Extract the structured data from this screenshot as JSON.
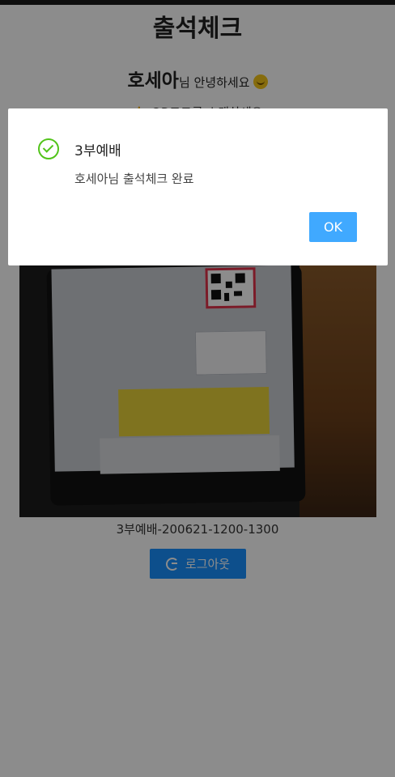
{
  "page": {
    "title": "출석체크",
    "greeting_name": "호세아",
    "greeting_rest": "님 안녕하세요",
    "instruction": "👉 QR코드를 스캔하세요",
    "scan_caption": "3부예배-200621-1200-1300",
    "logout_label": "로그아웃"
  },
  "modal": {
    "title": "3부예배",
    "content": "호세아님 출석체크 완료",
    "ok_label": "OK"
  },
  "colors": {
    "primary": "#1890ff",
    "ok_button": "#40a9ff",
    "success": "#52c41a"
  }
}
